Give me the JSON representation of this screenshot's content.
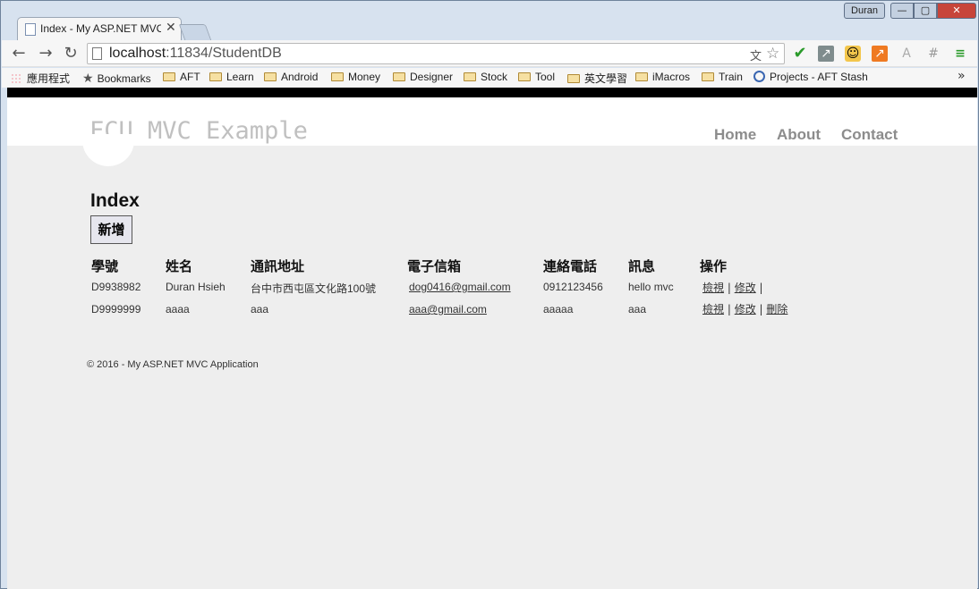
{
  "window": {
    "user": "Duran",
    "min": "—",
    "max": "▢",
    "close": "✕"
  },
  "tab": {
    "title": "Index - My ASP.NET MVC",
    "close": "✕"
  },
  "toolbar": {
    "back": "←",
    "forward": "→",
    "reload": "↻",
    "url_host": "localhost",
    "url_path": ":11834/StudentDB"
  },
  "bookmarks": {
    "apps": "應用程式",
    "bookmarks": "Bookmarks",
    "folders": [
      "AFT",
      "Learn",
      "Android",
      "Money",
      "Designer",
      "Stock",
      "Tool",
      "英文學習",
      "iMacros",
      "Train"
    ],
    "projects": "Projects - AFT Stash",
    "more": "»"
  },
  "page": {
    "brand": "FCU MVC Example",
    "nav": [
      "Home",
      "About",
      "Contact"
    ],
    "title": "Index",
    "add_button": "新增",
    "columns": [
      "學號",
      "姓名",
      "通訊地址",
      "電子信箱",
      "連絡電話",
      "訊息",
      "操作"
    ],
    "rows": [
      {
        "id": "D9938982",
        "name": "Duran Hsieh",
        "address": "台中市西屯區文化路100號",
        "email": "dog0416@gmail.com",
        "phone": "0912123456",
        "message": "hello mvc",
        "ops": [
          "檢視",
          "修改"
        ],
        "ops_tail": "|"
      },
      {
        "id": "D9999999",
        "name": "aaaa",
        "address": "aaa",
        "email": "aaa@gmail.com",
        "phone": "aaaaa",
        "message": "aaa",
        "ops": [
          "檢視",
          "修改",
          "刪除"
        ],
        "ops_tail": ""
      }
    ],
    "footer": "© 2016 - My ASP.NET MVC Application"
  }
}
